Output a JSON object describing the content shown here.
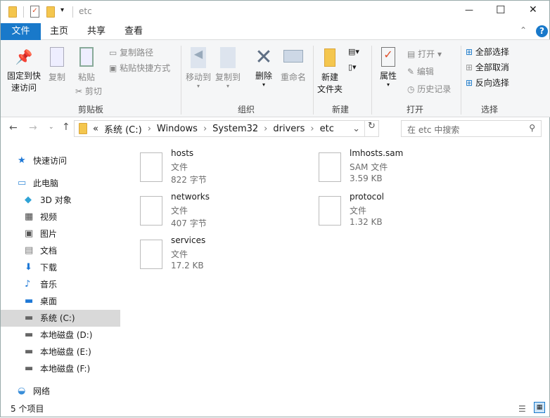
{
  "window": {
    "title": "etc",
    "minimize": "—",
    "maximize": "☐",
    "close": "✕"
  },
  "tabs": [
    "文件",
    "主页",
    "共享",
    "查看"
  ],
  "help": "?",
  "ribbon": {
    "clipboard": {
      "pin": "固定到快",
      "pin2": "速访问",
      "copy": "复制",
      "paste": "粘贴",
      "copy_path": "复制路径",
      "paste_shortcut": "粘贴快捷方式",
      "cut": "剪切",
      "label": "剪贴板"
    },
    "organize": {
      "move_to": "移动到",
      "copy_to": "复制到",
      "delete": "删除",
      "rename": "重命名",
      "label": "组织"
    },
    "new": {
      "new_folder": "新建",
      "new_folder2": "文件夹",
      "label": "新建"
    },
    "open": {
      "properties": "属性",
      "open": "打开",
      "edit": "编辑",
      "history": "历史记录",
      "label": "打开"
    },
    "select": {
      "select_all": "全部选择",
      "select_none": "全部取消",
      "invert": "反向选择",
      "label": "选择"
    }
  },
  "address": {
    "prefix": "«",
    "crumbs": [
      "系统 (C:)",
      "Windows",
      "System32",
      "drivers",
      "etc"
    ],
    "search_placeholder": "在 etc 中搜索"
  },
  "sidebar": [
    {
      "label": "快速访问",
      "icon": "star-icon",
      "color": "#1e78d6"
    },
    {
      "label": "此电脑",
      "icon": "computer-icon",
      "color": "#3a8ed9"
    },
    {
      "label": "3D 对象",
      "icon": "cube-icon",
      "color": "#2fa3d6"
    },
    {
      "label": "视频",
      "icon": "video-icon",
      "color": "#444"
    },
    {
      "label": "图片",
      "icon": "picture-icon",
      "color": "#555"
    },
    {
      "label": "文档",
      "icon": "document-icon",
      "color": "#777"
    },
    {
      "label": "下载",
      "icon": "download-icon",
      "color": "#1e78d6"
    },
    {
      "label": "音乐",
      "icon": "music-icon",
      "color": "#1e78d6"
    },
    {
      "label": "桌面",
      "icon": "desktop-icon",
      "color": "#1e78d6"
    },
    {
      "label": "系统 (C:)",
      "icon": "drive-c-icon",
      "color": "#666"
    },
    {
      "label": "本地磁盘 (D:)",
      "icon": "drive-icon",
      "color": "#666"
    },
    {
      "label": "本地磁盘 (E:)",
      "icon": "drive-icon",
      "color": "#666"
    },
    {
      "label": "本地磁盘 (F:)",
      "icon": "drive-icon",
      "color": "#666"
    },
    {
      "label": "网络",
      "icon": "network-icon",
      "color": "#3a8ed9"
    }
  ],
  "files": [
    {
      "name": "hosts",
      "type": "文件",
      "size": "822 字节"
    },
    {
      "name": "lmhosts.sam",
      "type": "SAM 文件",
      "size": "3.59 KB"
    },
    {
      "name": "networks",
      "type": "文件",
      "size": "407 字节"
    },
    {
      "name": "protocol",
      "type": "文件",
      "size": "1.32 KB"
    },
    {
      "name": "services",
      "type": "文件",
      "size": "17.2 KB"
    }
  ],
  "status": {
    "count": "5 个项目"
  },
  "colors": {
    "accent": "#1979ca",
    "selected": "#d9d9d9"
  }
}
